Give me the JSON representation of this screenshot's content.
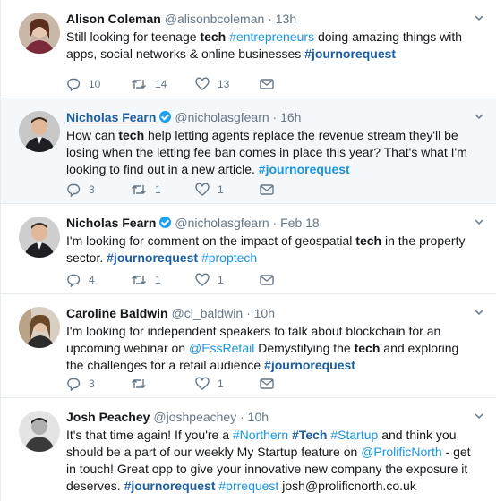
{
  "tweets": [
    {
      "name": "Alison Coleman",
      "handle": "@alisonbcoleman",
      "dot": "·",
      "time": "13h",
      "verified": false,
      "parts": [
        {
          "t": "Still looking for teenage "
        },
        {
          "t": "tech",
          "s": "b"
        },
        {
          "t": " "
        },
        {
          "t": "#entrepreneurs",
          "s": "tag"
        },
        {
          "t": " doing amazing things with apps, social networks & online businesses "
        },
        {
          "t": "#journorequest",
          "s": "tagb"
        }
      ],
      "replies": "10",
      "retweets": "14",
      "likes": "13"
    },
    {
      "name": "Nicholas Fearn",
      "handle": "@nicholasgfearn",
      "dot": "·",
      "time": "16h",
      "verified": true,
      "parts": [
        {
          "t": "How can "
        },
        {
          "t": "tech",
          "s": "b"
        },
        {
          "t": " help letting agents replace the revenue stream they'll be losing when the letting fee ban comes in place this year? That's what I'm looking to find out in a new article.  "
        },
        {
          "t": "#journorequest",
          "s": "tagb"
        }
      ],
      "replies": "3",
      "retweets": "1",
      "likes": "1"
    },
    {
      "name": "Nicholas Fearn",
      "handle": "@nicholasgfearn",
      "dot": "·",
      "time": "Feb 18",
      "verified": true,
      "parts": [
        {
          "t": "I'm looking for comment on the impact of geospatial "
        },
        {
          "t": "tech",
          "s": "b"
        },
        {
          "t": " in the property sector. "
        },
        {
          "t": "#journorequest",
          "s": "tagb"
        },
        {
          "t": " "
        },
        {
          "t": "#proptech",
          "s": "tag"
        }
      ],
      "replies": "4",
      "retweets": "1",
      "likes": "1"
    },
    {
      "name": "Caroline Baldwin",
      "handle": "@cl_baldwin",
      "dot": "·",
      "time": "10h",
      "verified": false,
      "parts": [
        {
          "t": "I'm looking for independent speakers to talk about blockchain for an upcoming webinar on "
        },
        {
          "t": "@EssRetail",
          "s": "tag"
        },
        {
          "t": " Demystifying the "
        },
        {
          "t": "tech",
          "s": "b"
        },
        {
          "t": " and exploring the challenges for a retail audience "
        },
        {
          "t": "#journorequest",
          "s": "tagb"
        }
      ],
      "replies": "3",
      "retweets": "",
      "likes": "1"
    },
    {
      "name": "Josh Peachey",
      "handle": "@joshpeachey",
      "dot": "·",
      "time": "10h",
      "verified": false,
      "parts": [
        {
          "t": "It's that time again! If you're a "
        },
        {
          "t": "#Northern",
          "s": "tag"
        },
        {
          "t": " "
        },
        {
          "t": "#Tech",
          "s": "tagb"
        },
        {
          "t": " "
        },
        {
          "t": "#Startup",
          "s": "tag"
        },
        {
          "t": " and think you should be a part of our weekly My Startup feature on "
        },
        {
          "t": "@ProlificNorth",
          "s": "tag"
        },
        {
          "t": " - get in touch! Great opp to give your innovative new company the exposure it deserves. "
        },
        {
          "t": "#journorequest",
          "s": "tagb"
        },
        {
          "t": " "
        },
        {
          "t": "#prrequest",
          "s": "tag"
        },
        {
          "t": " josh@prolificnorth.co.uk"
        }
      ],
      "replies": "",
      "retweets": "",
      "likes": ""
    }
  ],
  "colors": {
    "link": "#1b95e0",
    "link_strong": "#1b5ea0",
    "muted": "#657786",
    "hover_bg": "#f5f8fa"
  },
  "icons": [
    "reply-icon",
    "retweet-icon",
    "like-icon",
    "direct-message-icon",
    "chevron-down-icon",
    "verified-badge-icon"
  ]
}
